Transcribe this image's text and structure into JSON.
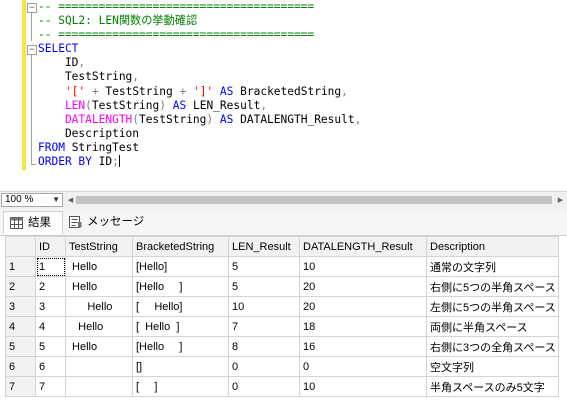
{
  "editor": {
    "lines": [
      [
        {
          "t": "-- ======================================",
          "c": "c-comment"
        }
      ],
      [
        {
          "t": "-- SQL2: LEN関数の挙動確認",
          "c": "c-comment"
        }
      ],
      [
        {
          "t": "-- ======================================",
          "c": "c-comment"
        }
      ],
      [
        {
          "t": "SELECT",
          "c": "c-kw"
        }
      ],
      [
        {
          "t": "    ID",
          "c": ""
        },
        {
          "t": ",",
          "c": "c-op"
        }
      ],
      [
        {
          "t": "    TestString",
          "c": ""
        },
        {
          "t": ",",
          "c": "c-op"
        }
      ],
      [
        {
          "t": "    '[' ",
          "c": "c-str"
        },
        {
          "t": "+",
          "c": "c-op"
        },
        {
          "t": " TestString ",
          "c": ""
        },
        {
          "t": "+",
          "c": "c-op"
        },
        {
          "t": " ']'",
          "c": "c-str"
        },
        {
          "t": " AS ",
          "c": "c-kw"
        },
        {
          "t": "BracketedString",
          "c": ""
        },
        {
          "t": ",",
          "c": "c-op"
        }
      ],
      [
        {
          "t": "    LEN",
          "c": "c-fn"
        },
        {
          "t": "(",
          "c": "c-op"
        },
        {
          "t": "TestString",
          "c": ""
        },
        {
          "t": ")",
          "c": "c-op"
        },
        {
          "t": " AS ",
          "c": "c-kw"
        },
        {
          "t": "LEN_Result",
          "c": ""
        },
        {
          "t": ",",
          "c": "c-op"
        }
      ],
      [
        {
          "t": "    DATALENGTH",
          "c": "c-fn"
        },
        {
          "t": "(",
          "c": "c-op"
        },
        {
          "t": "TestString",
          "c": ""
        },
        {
          "t": ")",
          "c": "c-op"
        },
        {
          "t": " AS ",
          "c": "c-kw"
        },
        {
          "t": "DATALENGTH_Result",
          "c": ""
        },
        {
          "t": ",",
          "c": "c-op"
        }
      ],
      [
        {
          "t": "    Description",
          "c": ""
        }
      ],
      [
        {
          "t": "FROM",
          "c": "c-kw"
        },
        {
          "t": " StringTest",
          "c": ""
        }
      ],
      [
        {
          "t": "ORDER BY",
          "c": "c-kw"
        },
        {
          "t": " ID",
          "c": ""
        },
        {
          "t": ";",
          "c": "c-op"
        }
      ]
    ]
  },
  "zoom": {
    "value": "100 %"
  },
  "tabs": {
    "results": "結果",
    "messages": "メッセージ"
  },
  "grid": {
    "columns": [
      "ID",
      "TestString",
      "BracketedString",
      "LEN_Result",
      "DATALENGTH_Result",
      "Description"
    ],
    "rows": [
      {
        "num": "1",
        "cells": [
          "1",
          " Hello",
          "[Hello]",
          "5",
          "10",
          "通常の文字列"
        ]
      },
      {
        "num": "2",
        "cells": [
          "2",
          " Hello",
          "[Hello     ]",
          "5",
          "20",
          "右側に5つの半角スペース"
        ]
      },
      {
        "num": "3",
        "cells": [
          "3",
          "      Hello",
          "[     Hello]",
          "10",
          "20",
          "左側に5つの半角スペース"
        ]
      },
      {
        "num": "4",
        "cells": [
          "4",
          "   Hello",
          "[  Hello  ]",
          "7",
          "18",
          "両側に半角スペース"
        ]
      },
      {
        "num": "5",
        "cells": [
          "5",
          " Hello",
          "[Hello     ]",
          "8",
          "16",
          "右側に3つの全角スペース"
        ]
      },
      {
        "num": "6",
        "cells": [
          "6",
          "",
          "[]",
          "0",
          "0",
          "空文字列"
        ]
      },
      {
        "num": "7",
        "cells": [
          "7",
          "",
          "[     ]",
          "0",
          "10",
          "半角スペースのみ5文字"
        ]
      }
    ]
  }
}
